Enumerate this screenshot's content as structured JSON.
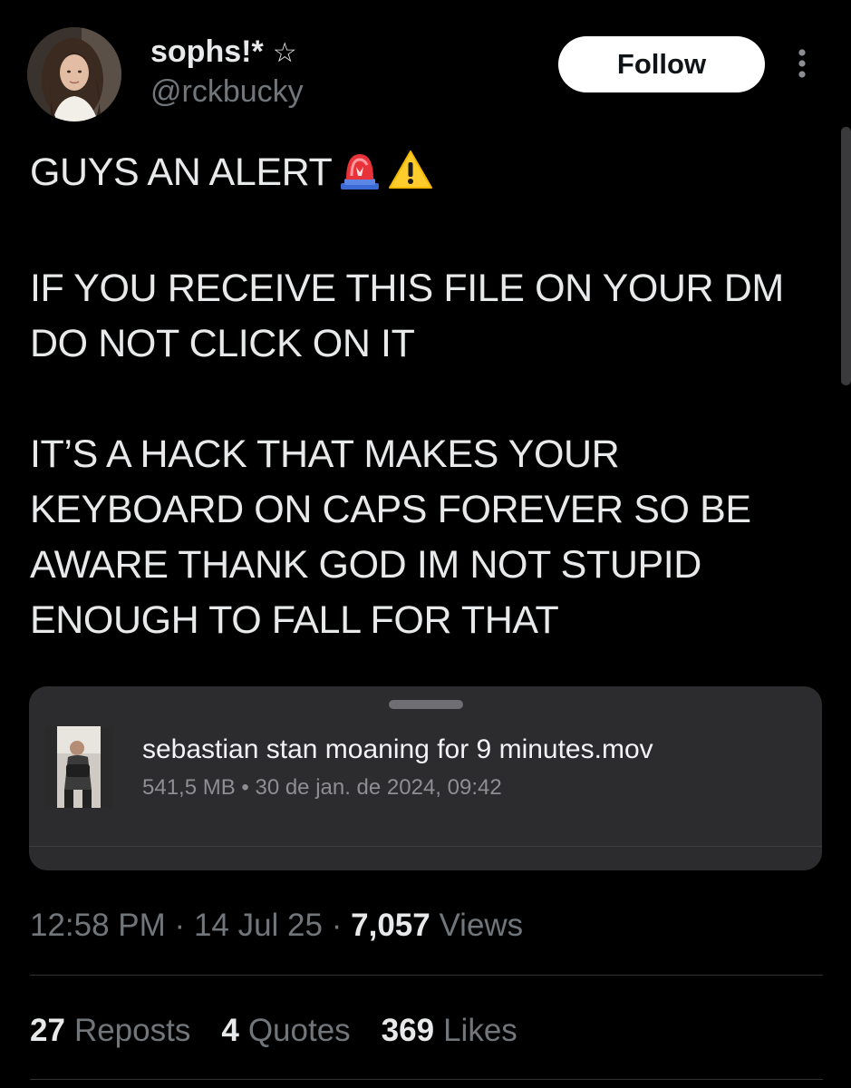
{
  "author": {
    "display_name": "sophs!*",
    "name_symbol": "☆",
    "handle": "@rckbucky"
  },
  "follow_button": {
    "label": "Follow"
  },
  "tweet": {
    "text": "GUYS AN ALERT",
    "text_emojis": [
      "police-car-light-icon",
      "warning-icon"
    ],
    "paragraphs": [
      "IF YOU RECEIVE THIS FILE ON YOUR DM DO NOT CLICK ON IT",
      "IT’S A HACK THAT MAKES YOUR KEYBOARD ON CAPS FOREVER SO BE AWARE THANK GOD IM NOT STUPID ENOUGH TO FALL FOR THAT"
    ]
  },
  "attachment": {
    "file_name": "sebastian stan moaning for 9 minutes.mov",
    "file_meta": "541,5 MB • 30 de jan. de 2024, 09:42"
  },
  "meta": {
    "time": "12:58 PM",
    "date": "14 Jul 25",
    "views_count": "7,057",
    "views_label": "Views",
    "separator": "·"
  },
  "stats": {
    "reposts": {
      "count": "27",
      "label": "Reposts"
    },
    "quotes": {
      "count": "4",
      "label": "Quotes"
    },
    "likes": {
      "count": "369",
      "label": "Likes"
    }
  },
  "colors": {
    "background": "#000000",
    "text_primary": "#e7e9ea",
    "text_secondary": "#71767b",
    "card_background": "#2c2c2e",
    "follow_button_bg": "#ffffff"
  }
}
